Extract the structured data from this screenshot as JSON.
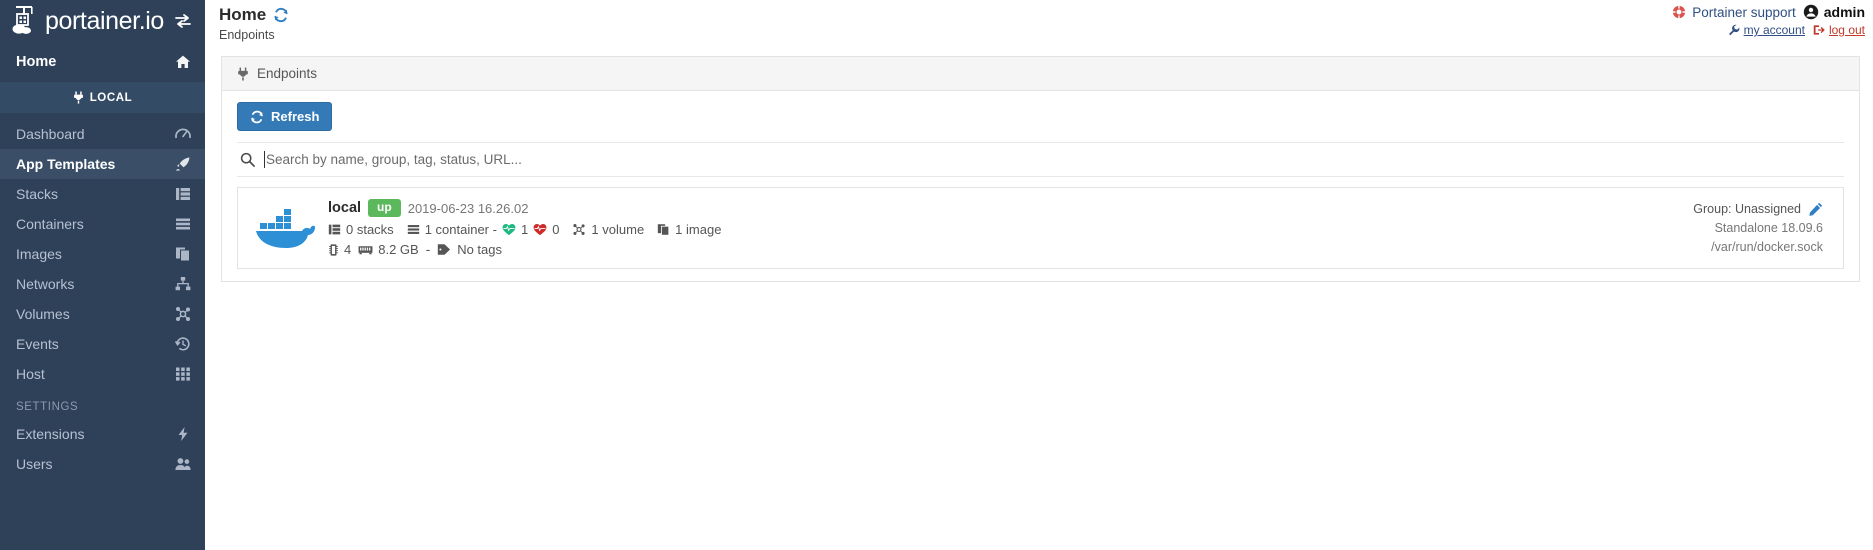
{
  "sidebar": {
    "brand": "portainer.io",
    "toggle_icon": "exchange-arrows-icon",
    "home_label": "Home",
    "home_icon": "home-icon",
    "local_label": "LOCAL",
    "local_icon": "plug-icon",
    "items": [
      {
        "label": "Dashboard",
        "icon": "dashboard-icon",
        "active": false
      },
      {
        "label": "App Templates",
        "icon": "rocket-icon",
        "active": true
      },
      {
        "label": "Stacks",
        "icon": "stacks-icon",
        "active": false
      },
      {
        "label": "Containers",
        "icon": "containers-icon",
        "active": false
      },
      {
        "label": "Images",
        "icon": "images-icon",
        "active": false
      },
      {
        "label": "Networks",
        "icon": "networks-icon",
        "active": false
      },
      {
        "label": "Volumes",
        "icon": "volumes-icon",
        "active": false
      },
      {
        "label": "Events",
        "icon": "history-icon",
        "active": false
      },
      {
        "label": "Host",
        "icon": "grid-icon",
        "active": false
      }
    ],
    "settings_section": "SETTINGS",
    "settings_items": [
      {
        "label": "Extensions",
        "icon": "bolt-icon",
        "active": false
      },
      {
        "label": "Users",
        "icon": "users-icon",
        "active": false
      }
    ]
  },
  "header": {
    "title": "Home",
    "title_icon": "refresh-icon",
    "subtitle": "Endpoints",
    "support_label": "Portainer support",
    "support_icon": "lifebuoy-icon",
    "user_label": "admin",
    "user_icon": "user-circle-icon",
    "my_account_label": "my account",
    "my_account_icon": "wrench-icon",
    "logout_label": "log out",
    "logout_icon": "sign-out-icon"
  },
  "panel": {
    "title": "Endpoints",
    "title_icon": "plug-icon",
    "refresh_label": "Refresh",
    "refresh_icon": "refresh-icon"
  },
  "search": {
    "icon": "search-icon",
    "value": "",
    "placeholder": "Search by name, group, tag, status, URL..."
  },
  "endpoint": {
    "logo_icon": "docker-whale-icon",
    "name": "local",
    "status": "up",
    "timestamp": "2019-06-23 16.26.02",
    "stacks": "0 stacks",
    "stacks_icon": "stacks-icon",
    "containers": "1 container -",
    "containers_icon": "containers-icon",
    "healthy_count": "1",
    "healthy_icon": "heartbeat-green-icon",
    "unhealthy_count": "0",
    "unhealthy_icon": "heartbeat-red-icon",
    "volumes": "1 volume",
    "volumes_icon": "volumes-icon",
    "images": "1 image",
    "images_icon": "images-icon",
    "cpu": "4",
    "cpu_icon": "cpu-icon",
    "memory": "8.2 GB",
    "memory_icon": "memory-icon",
    "separator": "-",
    "tags": "No tags",
    "tags_icon": "tag-icon",
    "group": "Group: Unassigned",
    "group_edit_icon": "pencil-icon",
    "version": "Standalone 18.09.6",
    "url": "/var/run/docker.sock"
  },
  "colors": {
    "sidebar_bg": "#2e4159",
    "sidebar_active": "#3a4e68",
    "primary_blue": "#337ab7",
    "status_green": "#5cb85c",
    "link_blue": "#2f4f82",
    "logout_red": "#c0392b",
    "docker_blue": "#2d8fd5"
  }
}
